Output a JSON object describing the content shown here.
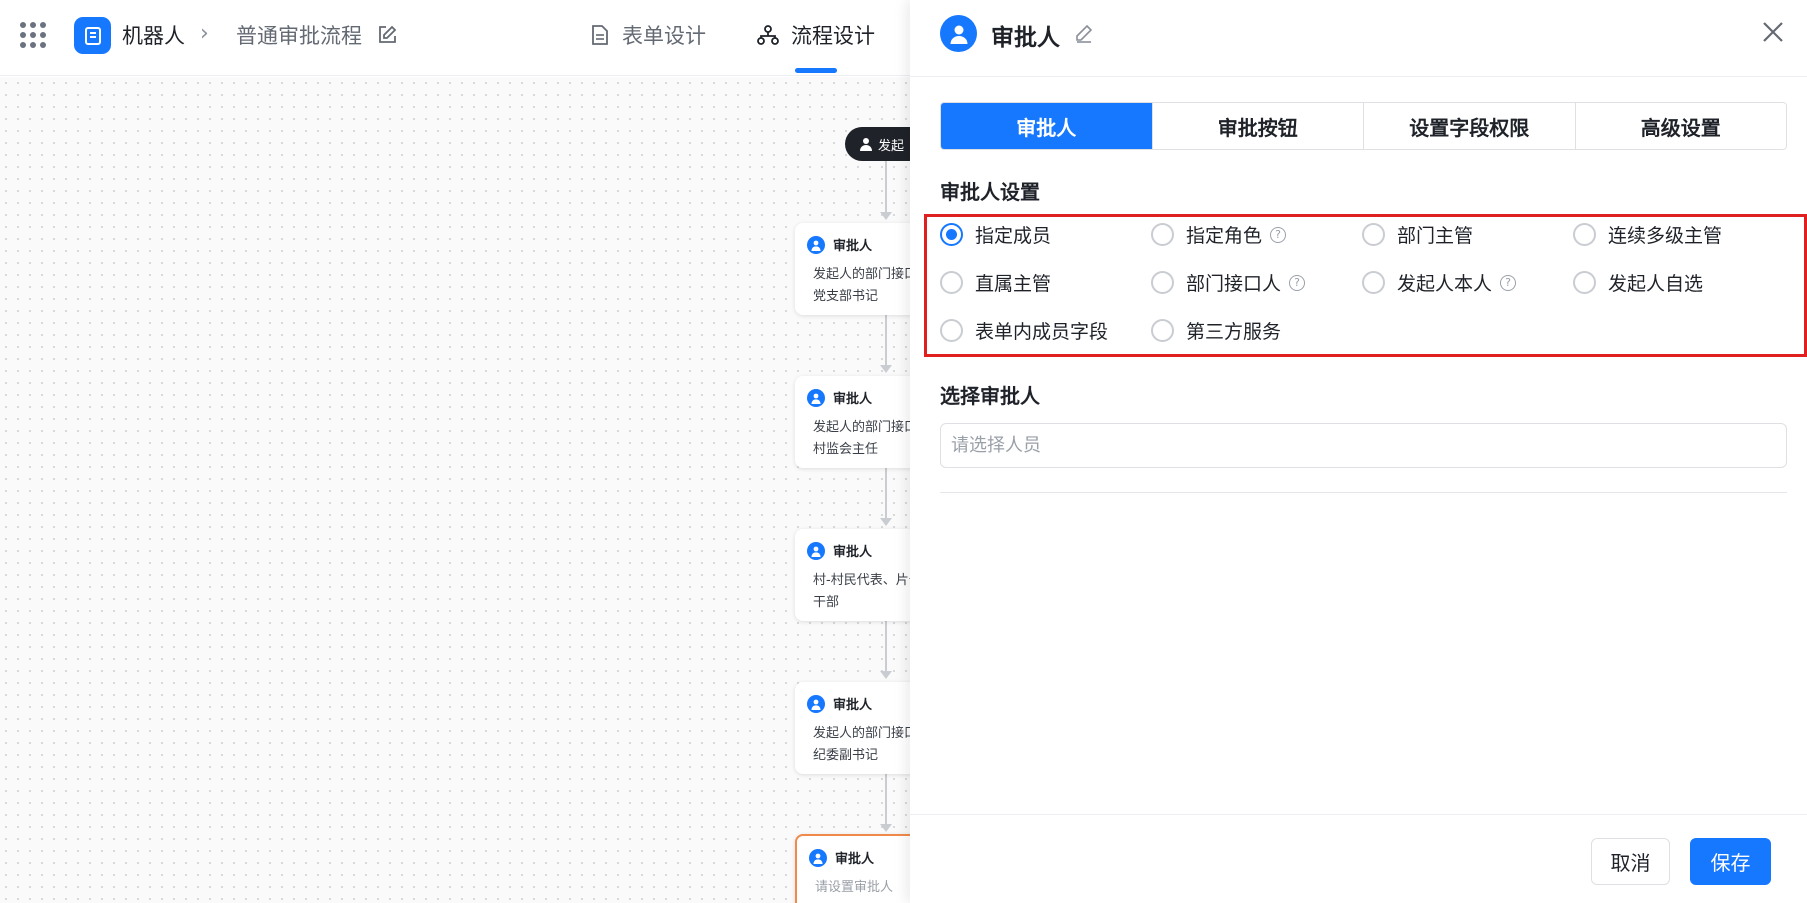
{
  "header": {
    "app_name": "机器人",
    "breadcrumb_separator": "›",
    "flow_name": "普通审批流程",
    "tabs": [
      {
        "label": "表单设计",
        "active": false
      },
      {
        "label": "流程设计",
        "active": true
      }
    ]
  },
  "canvas": {
    "start_node_label": "发起",
    "nodes": [
      {
        "title": "审批人",
        "body_line1": "发起人的部门接口",
        "body_line2": "党支部书记"
      },
      {
        "title": "审批人",
        "body_line1": "发起人的部门接口",
        "body_line2": "村监会主任"
      },
      {
        "title": "审批人",
        "body_line1": "村-村民代表、片长",
        "body_line2": "干部"
      },
      {
        "title": "审批人",
        "body_line1": "发起人的部门接口",
        "body_line2": "纪委副书记"
      },
      {
        "title": "审批人",
        "body_line1": "请设置审批人",
        "body_line2": ""
      }
    ]
  },
  "drawer": {
    "title": "审批人",
    "segments": [
      {
        "label": "审批人",
        "active": true
      },
      {
        "label": "审批按钮",
        "active": false
      },
      {
        "label": "设置字段权限",
        "active": false
      },
      {
        "label": "高级设置",
        "active": false
      }
    ],
    "approver_settings_title": "审批人设置",
    "approver_types": [
      {
        "label": "指定成员",
        "checked": true,
        "help": false
      },
      {
        "label": "指定角色",
        "checked": false,
        "help": true
      },
      {
        "label": "部门主管",
        "checked": false,
        "help": false
      },
      {
        "label": "连续多级主管",
        "checked": false,
        "help": false
      },
      {
        "label": "直属主管",
        "checked": false,
        "help": false
      },
      {
        "label": "部门接口人",
        "checked": false,
        "help": true
      },
      {
        "label": "发起人本人",
        "checked": false,
        "help": true
      },
      {
        "label": "发起人自选",
        "checked": false,
        "help": false
      },
      {
        "label": "表单内成员字段",
        "checked": false,
        "help": false
      },
      {
        "label": "第三方服务",
        "checked": false,
        "help": false
      }
    ],
    "help_glyph": "?",
    "select_approver_title": "选择审批人",
    "select_approver_placeholder": "请选择人员",
    "footer": {
      "cancel_label": "取消",
      "save_label": "保存"
    }
  },
  "colors": {
    "primary": "#1677ff",
    "highlight_border": "#e01f1f",
    "active_node_border": "#f08a4b"
  },
  "icons": {
    "app_menu": "grid-dots-icon",
    "app_logo": "document-app-icon",
    "edit": "edit-icon",
    "form_tab": "file-text-icon",
    "flow_tab": "flow-tree-icon",
    "approver": "user-circle-icon",
    "close": "close-icon",
    "help": "question-circle-icon"
  }
}
